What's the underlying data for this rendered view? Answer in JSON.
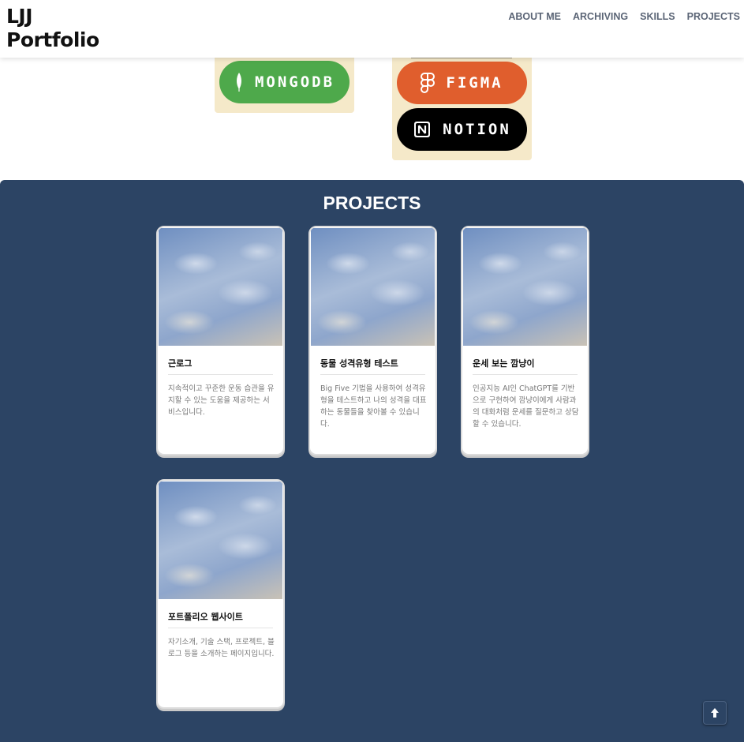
{
  "header": {
    "logo_line1": "LJJ",
    "logo_line2": "Portfolio",
    "nav": [
      "ABOUT ME",
      "ARCHIVING",
      "SKILLS",
      "PROJECTS"
    ]
  },
  "skills": {
    "badges": [
      {
        "label": "MONGODB",
        "icon": "mongodb-leaf-icon",
        "color": "#4ea94b"
      },
      {
        "label": "FIGMA",
        "icon": "figma-icon",
        "color": "#e05e2d"
      },
      {
        "label": "NOTION",
        "icon": "notion-icon",
        "color": "#000000"
      }
    ],
    "box_color": "#f5e9c9"
  },
  "projects": {
    "title": "PROJECTS",
    "background": "#2c4464",
    "cards": [
      {
        "title": "근로그",
        "desc": "지속적이고 꾸준한 운동 습관을 유지할 수 있는 도움을 제공하는 서비스입니다."
      },
      {
        "title": "동물 성격유형 테스트",
        "desc": "Big Five 기법을 사용하여 성격유형을 테스트하고 나의 성격을 대표하는 동물들을 찾아볼 수 있습니다."
      },
      {
        "title": "운세 보는 깜냥이",
        "desc": "인공지능 AI인 ChatGPT를 기반으로 구현하여 깜냥이에게 사람과의 대화처럼 운세를 질문하고 상담할 수 있습니다."
      },
      {
        "title": "포트폴리오 웹사이트",
        "desc": "자기소개, 기술 스택, 프로젝트, 블로그 등을 소개하는 페이지입니다."
      }
    ]
  },
  "scroll_top_icon": "arrow-up-icon"
}
